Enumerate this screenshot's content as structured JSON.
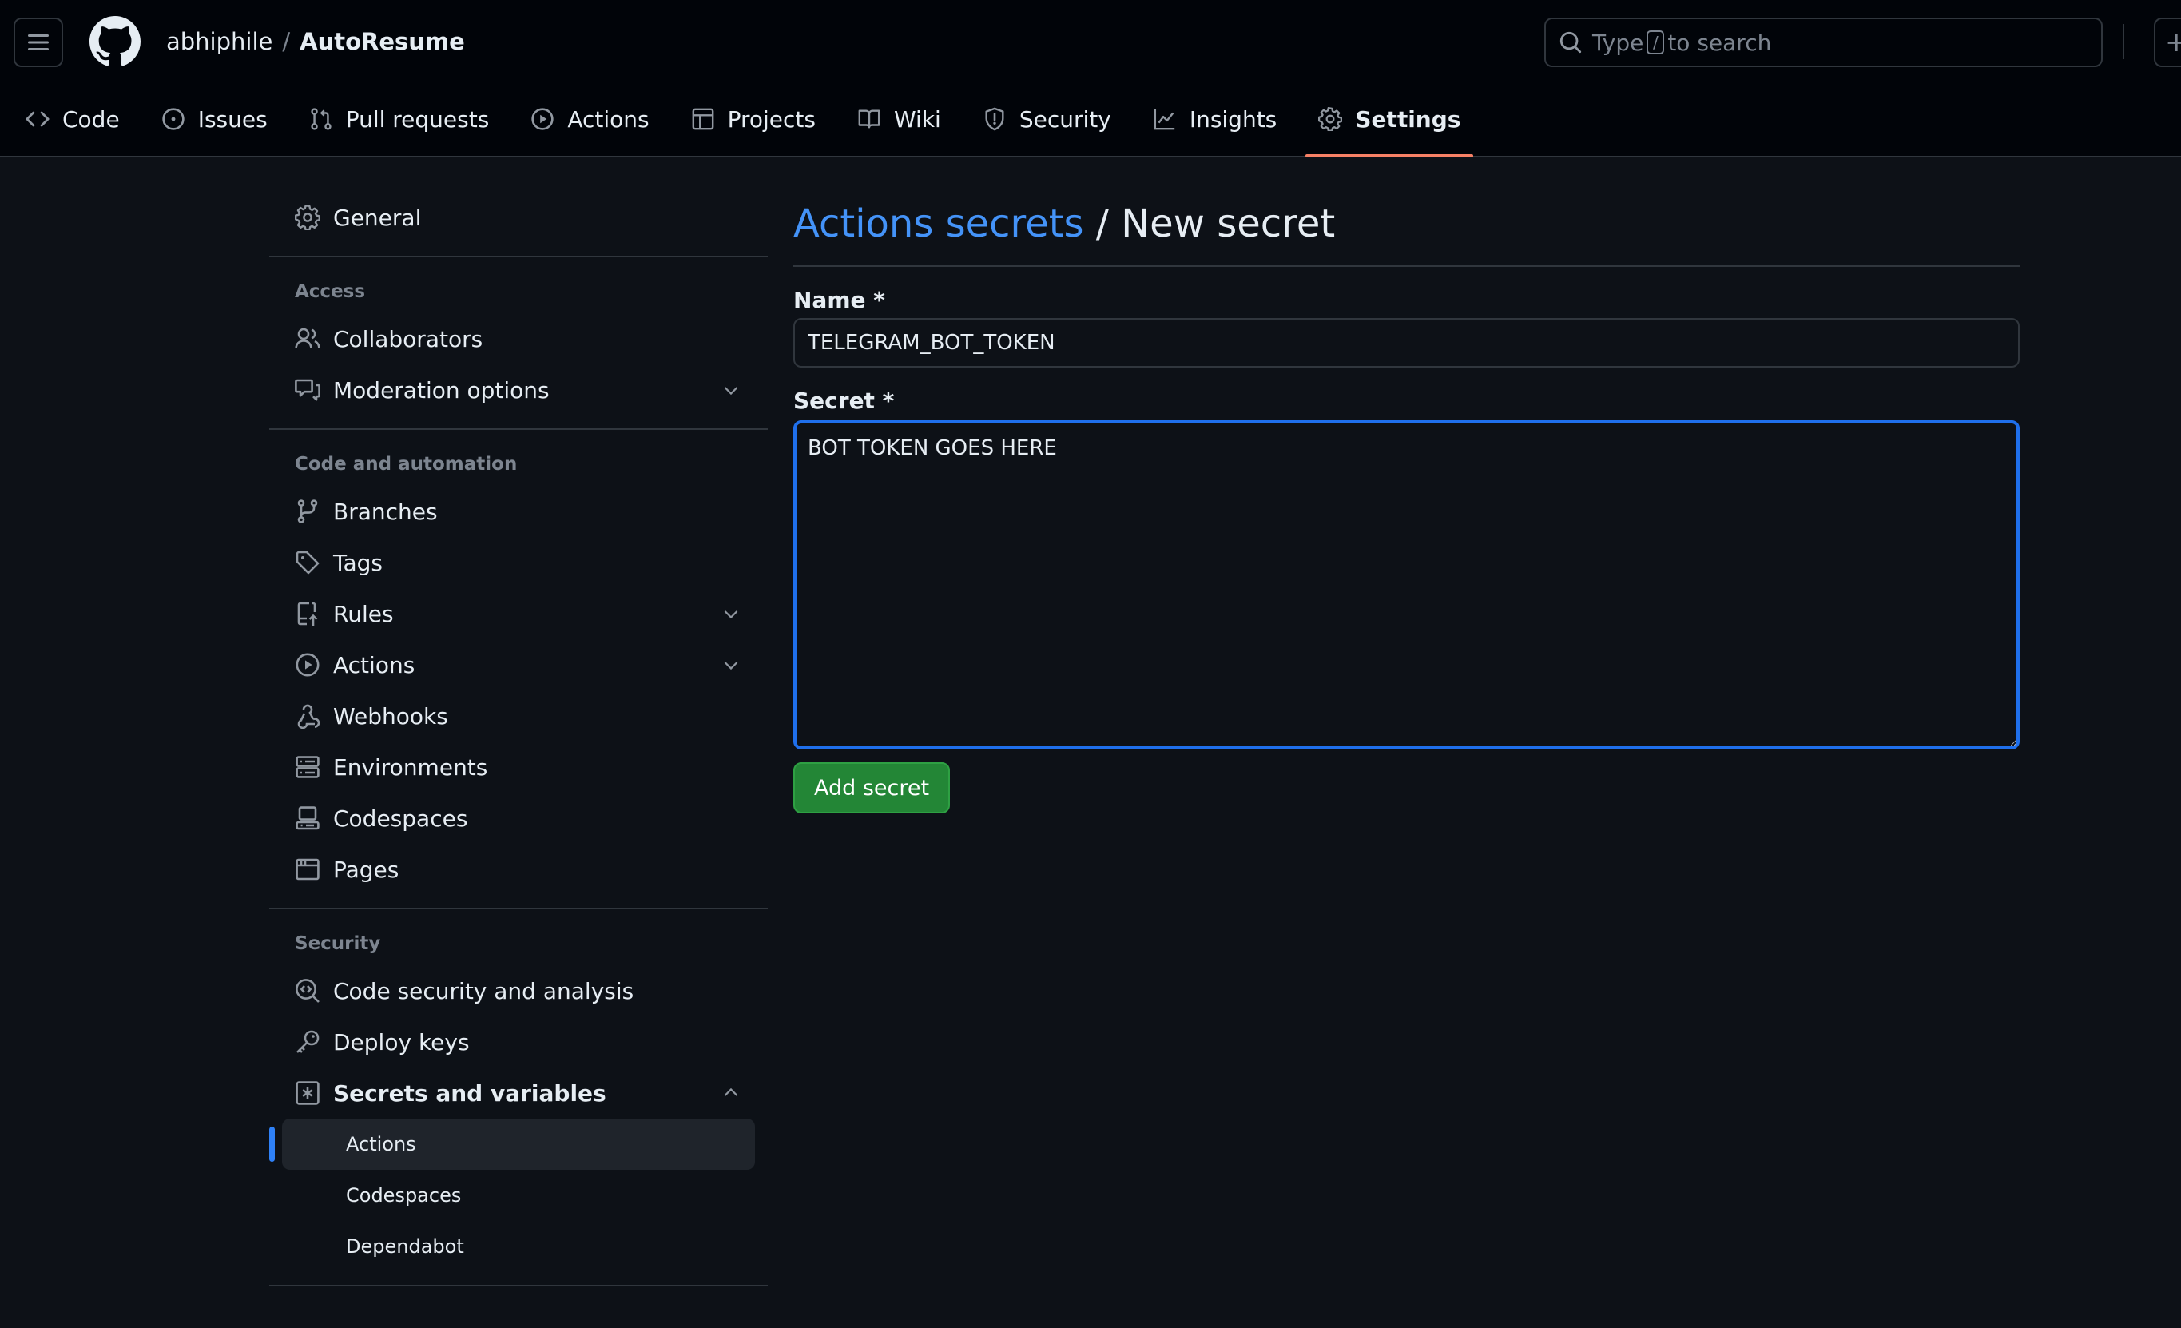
{
  "header": {
    "owner": "abhiphile",
    "separator": "/",
    "repo": "AutoResume",
    "search_prefix": "Type",
    "search_key": "/",
    "search_suffix": "to search",
    "plus_label": "+"
  },
  "tabs": [
    {
      "label": "Code",
      "icon": "code-icon"
    },
    {
      "label": "Issues",
      "icon": "issue-icon"
    },
    {
      "label": "Pull requests",
      "icon": "pull-request-icon"
    },
    {
      "label": "Actions",
      "icon": "play-icon"
    },
    {
      "label": "Projects",
      "icon": "table-icon"
    },
    {
      "label": "Wiki",
      "icon": "book-icon"
    },
    {
      "label": "Security",
      "icon": "shield-icon"
    },
    {
      "label": "Insights",
      "icon": "graph-icon"
    },
    {
      "label": "Settings",
      "icon": "gear-icon",
      "active": true
    }
  ],
  "sidebar": {
    "general": "General",
    "access_heading": "Access",
    "collaborators": "Collaborators",
    "moderation": "Moderation options",
    "code_heading": "Code and automation",
    "branches": "Branches",
    "tags": "Tags",
    "rules": "Rules",
    "actions": "Actions",
    "webhooks": "Webhooks",
    "environments": "Environments",
    "codespaces": "Codespaces",
    "pages": "Pages",
    "security_heading": "Security",
    "code_security": "Code security and analysis",
    "deploy_keys": "Deploy keys",
    "secrets": "Secrets and variables",
    "secrets_sub": [
      "Actions",
      "Codespaces",
      "Dependabot"
    ]
  },
  "main": {
    "title_link": "Actions secrets",
    "title_rest": " / New secret",
    "name_label": "Name *",
    "name_value": "TELEGRAM_BOT_TOKEN",
    "secret_label": "Secret *",
    "secret_value": "BOT TOKEN GOES HERE",
    "submit_label": "Add secret"
  },
  "colors": {
    "accent": "#4493f8",
    "focus_border": "#1f6feb",
    "tab_underline": "#f78166",
    "primary_button": "#238636"
  }
}
